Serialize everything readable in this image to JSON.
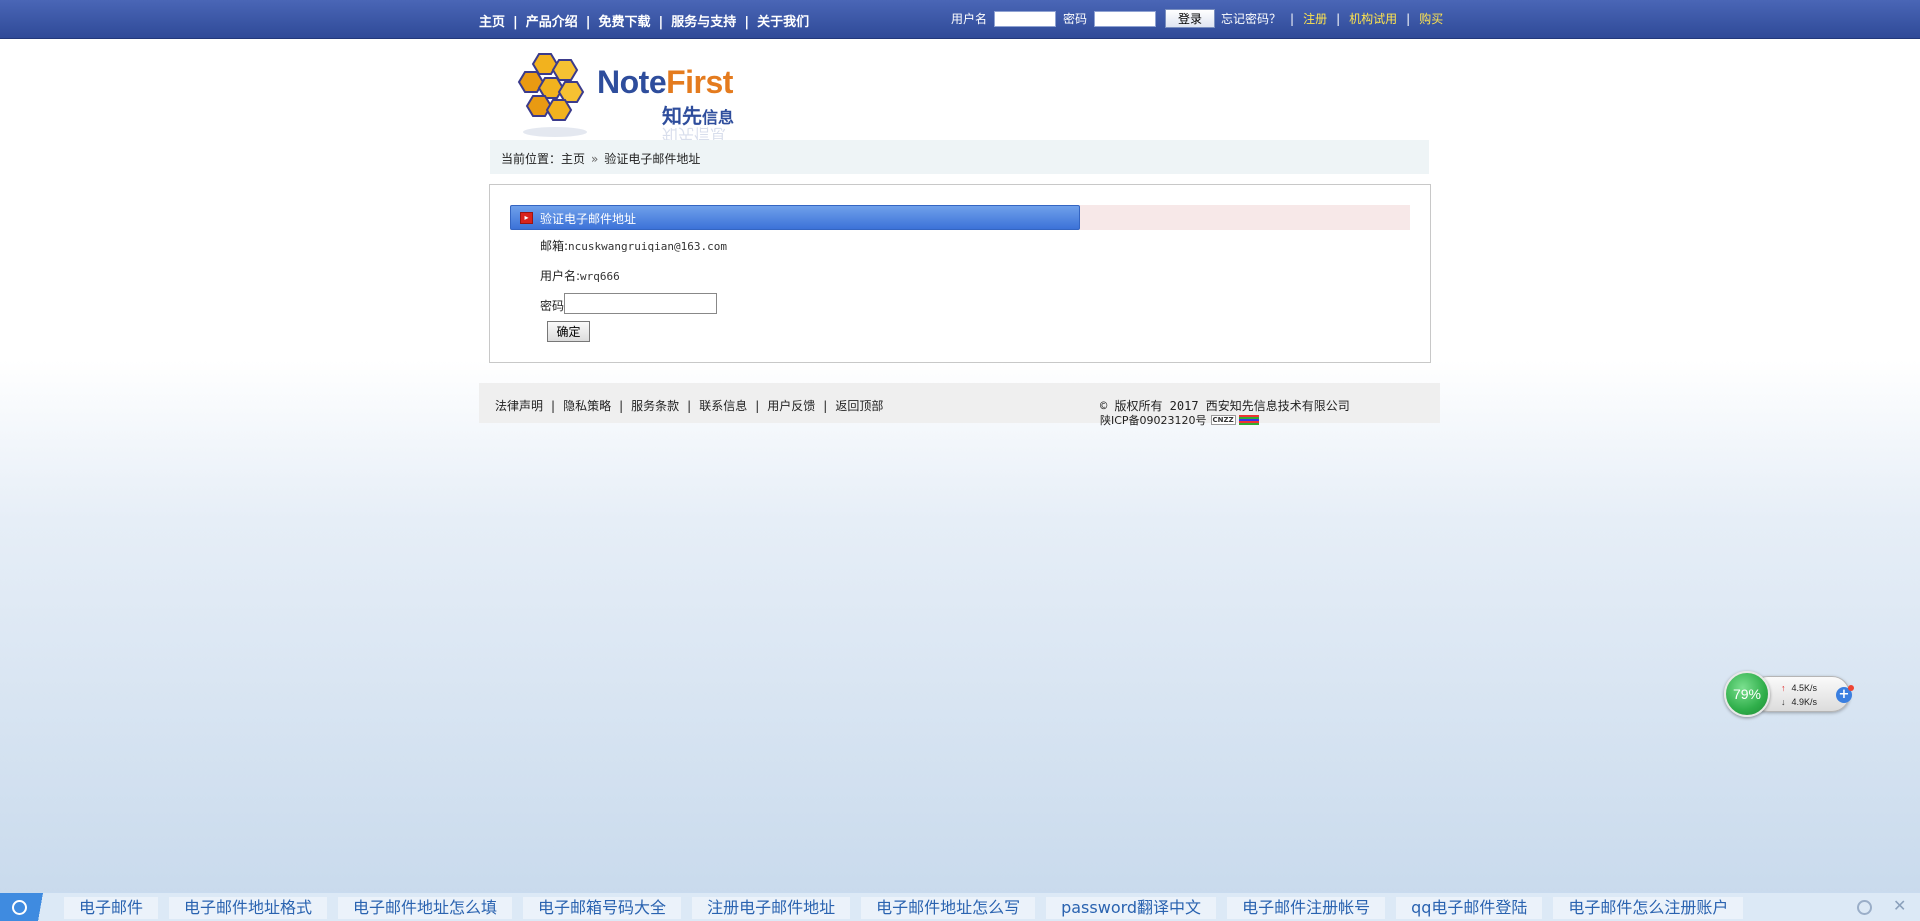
{
  "nav": {
    "items": [
      "主页",
      "产品介绍",
      "免费下载",
      "服务与支持",
      "关于我们"
    ]
  },
  "login": {
    "username_label": "用户名",
    "password_label": "密码",
    "login_button": "登录",
    "forgot": "忘记密码？",
    "register": "注册",
    "trial": "机构试用",
    "buy": "购买"
  },
  "logo": {
    "brand_part1": "Note",
    "brand_part2": "First",
    "cn_part1": "知先",
    "cn_part2": "信息"
  },
  "breadcrumb": {
    "prefix": "当前位置：",
    "home": "主页",
    "separator": "»",
    "current": "验证电子邮件地址"
  },
  "verify": {
    "title": "验证电子邮件地址",
    "email_label": "邮箱:",
    "email_value": "ncuskwangruiqian@163.com",
    "username_label": "用户名:",
    "username_value": "wrq666",
    "password_label": "密码",
    "password_value": "",
    "submit": "确定"
  },
  "footer": {
    "links": [
      "法律声明",
      "隐私策略",
      "服务条款",
      "联系信息",
      "用户反馈",
      "返回顶部"
    ],
    "copyright": "© 版权所有 2017 西安知先信息技术有限公司",
    "icp": "陕ICP备09023120号",
    "cnzz": "CNZZ"
  },
  "speed_widget": {
    "percent": "79%",
    "upload": "4.5K/s",
    "download": "4.9K/s"
  },
  "bottom_bar": {
    "items": [
      "电子邮件",
      "电子邮件地址格式",
      "电子邮件地址怎么填",
      "电子邮箱号码大全",
      "注册电子邮件地址",
      "电子邮件地址怎么写",
      "password翻译中文",
      "电子邮件注册帐号",
      "qq电子邮件登陆",
      "电子邮件怎么注册账户"
    ]
  },
  "colors": {
    "topbar": "#3a56a8",
    "accent_yellow": "#ffe44d",
    "title_blue": "#3c72d8",
    "bottom_link": "#2a63b0"
  }
}
